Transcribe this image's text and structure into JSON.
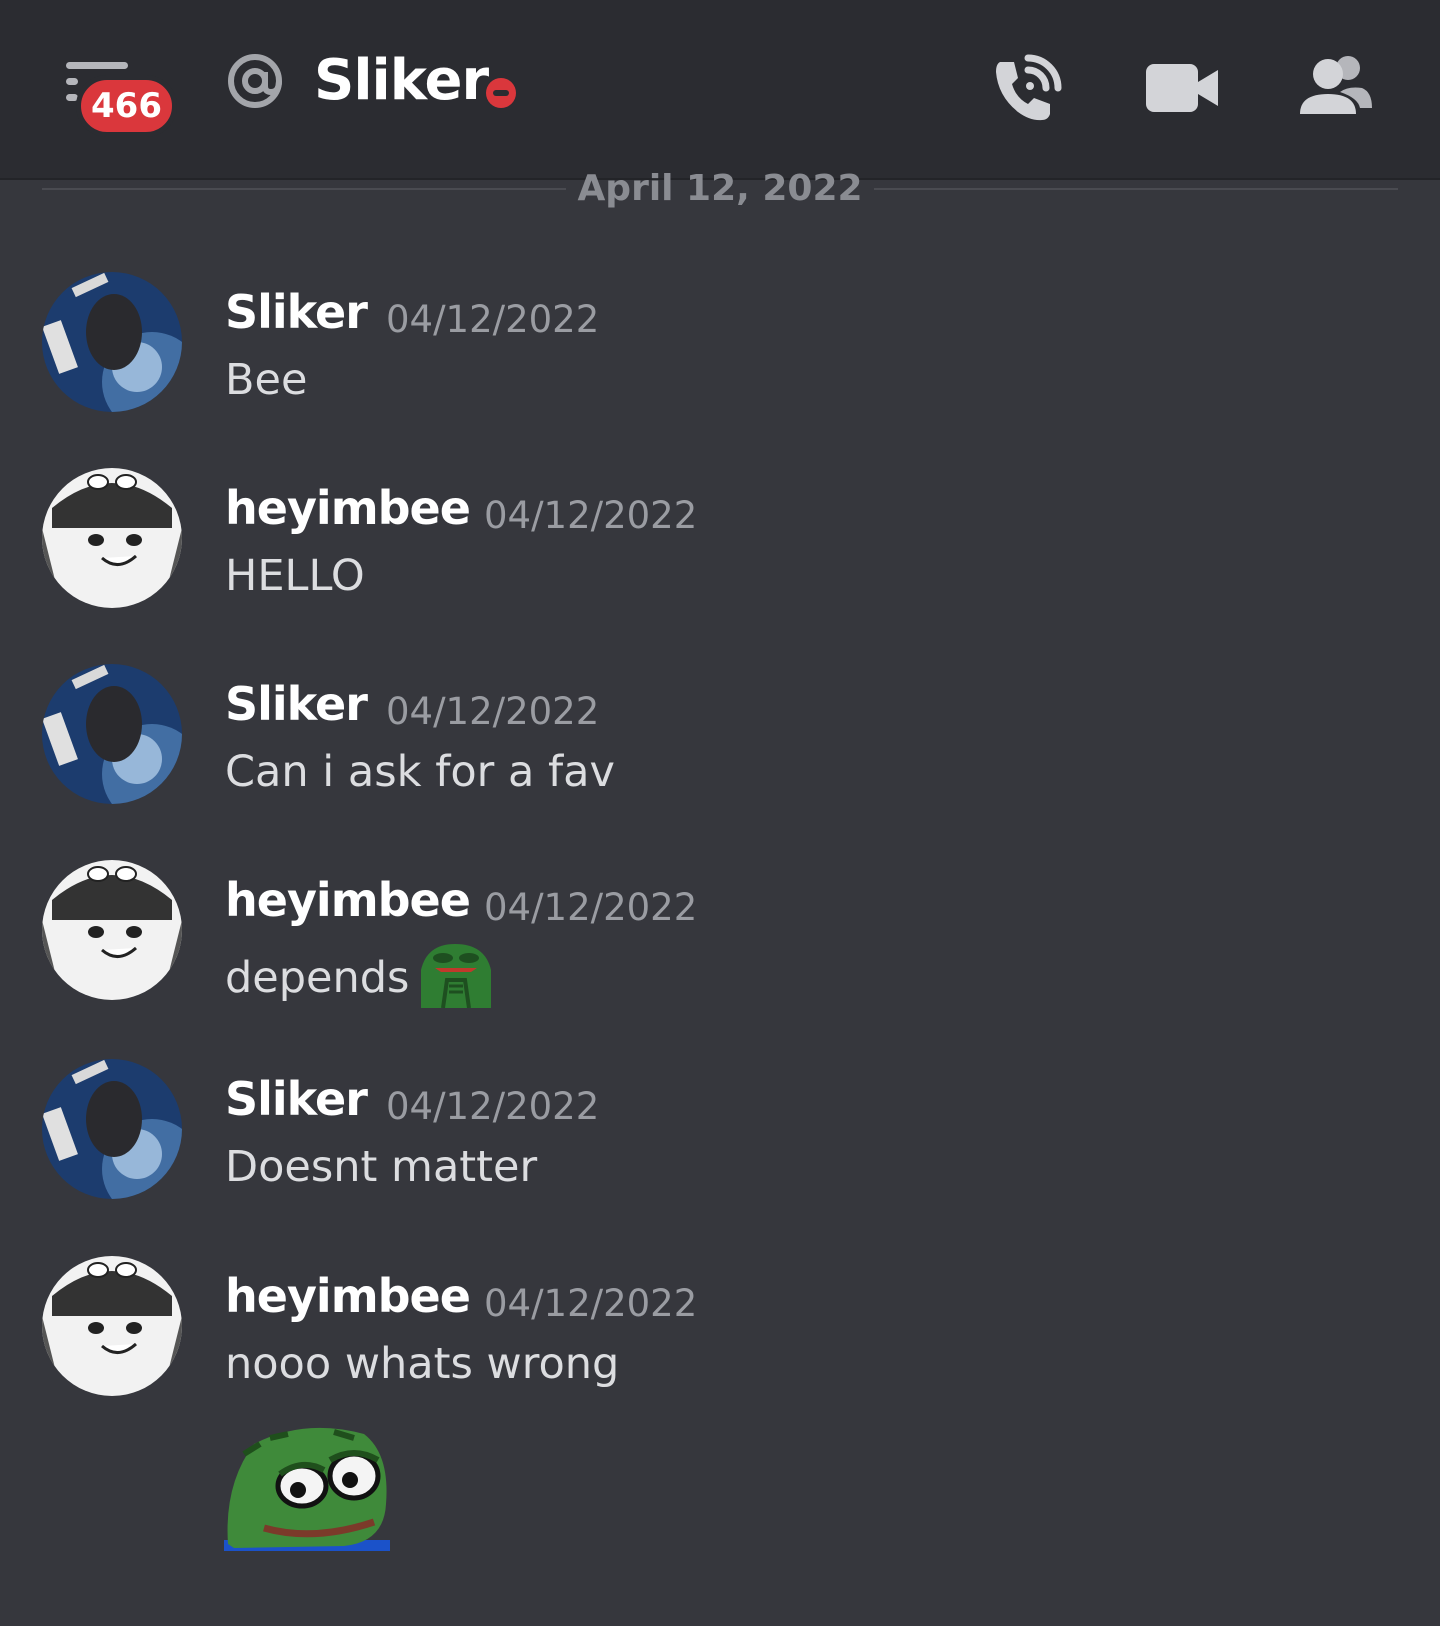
{
  "header": {
    "unread_count": "466",
    "channel_name": "Sliker",
    "icons": {
      "menu": "hamburger-menu-icon",
      "at": "at-sign-icon",
      "status": "do-not-disturb-status",
      "call": "phone-call-icon",
      "video": "video-camera-icon",
      "members": "members-icon"
    }
  },
  "divider": {
    "date": "April 12, 2022"
  },
  "messages": [
    {
      "author": "Sliker",
      "timestamp": "04/12/2022",
      "text": "Bee"
    },
    {
      "author": "heyimbee",
      "timestamp": "04/12/2022",
      "text": "HELLO"
    },
    {
      "author": "Sliker",
      "timestamp": "04/12/2022",
      "text": "Can i ask for a fav"
    },
    {
      "author": "heyimbee",
      "timestamp": "04/12/2022",
      "text": "depends",
      "emoji": "pepe-emoji"
    },
    {
      "author": "Sliker",
      "timestamp": "04/12/2022",
      "text": "Doesnt matter"
    },
    {
      "author": "heyimbee",
      "timestamp": "04/12/2022",
      "text": "nooo whats wrong",
      "sticker": "pepe-sticker"
    }
  ],
  "colors": {
    "background": "#36373d",
    "header": "#2b2c31",
    "badge": "#da373c",
    "author": "#ffffff",
    "timestamp": "#9a9ca2",
    "text": "#dcdde0"
  }
}
